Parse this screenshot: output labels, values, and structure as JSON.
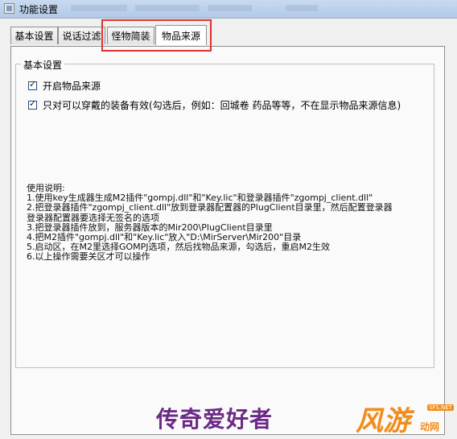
{
  "window": {
    "title": "功能设置"
  },
  "tabs": [
    {
      "label": "基本设置"
    },
    {
      "label": "说话过滤"
    },
    {
      "label": "怪物简装"
    },
    {
      "label": "物品来源"
    }
  ],
  "group": {
    "label": "基本设置",
    "options": [
      {
        "label": "开启物品来源",
        "checked": true
      },
      {
        "label": "只对可以穿戴的装备有效(勾选后，例如：回城卷 药品等等，不在显示物品来源信息)",
        "checked": true
      }
    ]
  },
  "instructions": [
    "使用说明:",
    "1.使用key生成器生成M2插件\"gompj.dll\"和\"Key.lic\"和登录器插件\"zgompj_client.dll\"",
    "2.把登录器插件\"zgompj_client.dll\"放到登录器配置器的PlugClient目录里，然后配置登录器",
    "登录器配置器要选择无签名的选项",
    "3.把登录器插件放到，服务器版本的Mir200\\PlugClient目录里",
    "4.把M2插件\"gompj.dll\"和\"Key.lic\"放入\"D:\\MirServer\\Mir200\"目录",
    "5.启动区，在M2里选择GOMPJ选项，然后找物品来源，勾选后，重启M2生效",
    "6.以上操作需要关区才可以操作"
  ],
  "watermark": {
    "left": "传奇爱好者",
    "right": "风游",
    "right_sub": "动网",
    "badge": "SFS.NET"
  },
  "colors": {
    "highlight": "#e03030",
    "watermark_purple": "#6b2a86",
    "watermark_orange": "#f28c1a"
  }
}
